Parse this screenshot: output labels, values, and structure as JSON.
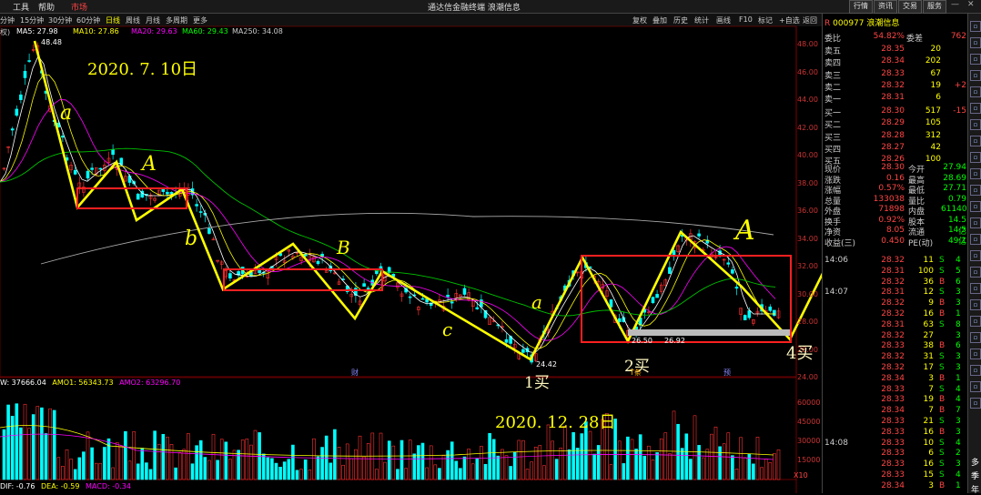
{
  "topbar": {
    "menus": [
      "工具",
      "帮助",
      "市场"
    ],
    "title": "通达信金融终端 浪潮信息",
    "right_buttons": [
      "行情",
      "资讯",
      "交易",
      "服务"
    ]
  },
  "toolbar": {
    "periods": [
      "分钟",
      "15分钟",
      "30分钟",
      "60分钟",
      "日线",
      "周线",
      "月线",
      "多周期",
      "更多"
    ],
    "active": "日线",
    "right": [
      "复权",
      "叠加",
      "历史",
      "统计",
      "画线",
      "F10",
      "标记",
      "+自选",
      "返回"
    ]
  },
  "ma_info": {
    "prefix": "权)",
    "ma5": "MA5: 27.98",
    "ma10": "MA10: 27.86",
    "ma20": "MA20: 29.63",
    "ma60": "MA60: 29.43",
    "ma250": "MA250: 34.08"
  },
  "price_labels": {
    "high": "48.48",
    "low1": "24.42",
    "low2": "26.50",
    "low3": "26.92"
  },
  "price_axis": [
    "48.00",
    "46.00",
    "44.00",
    "42.00",
    "40.00",
    "38.00",
    "36.00",
    "34.00",
    "32.00",
    "30.00",
    "28.00",
    "26.00",
    "24.00"
  ],
  "volume_info": {
    "vol": "W: 37666.04",
    "amo1": "AMO1: 56343.73",
    "amo2": "AMO2: 63296.70"
  },
  "volume_axis": [
    "60000",
    "45000",
    "30000",
    "15000"
  ],
  "volume_unit": "X10",
  "macd_info": {
    "dif": "DIF: -0.76",
    "dea": "DEA: -0.59",
    "macd": "MACD: -0.34"
  },
  "annotations": {
    "date1": "2020. 7. 10日",
    "date2": "2020. 12. 28日",
    "buy1": "1买",
    "buy2": "2买",
    "buy4": "4买",
    "a1": "a",
    "A1": "A",
    "b": "b",
    "B": "B",
    "c": "c",
    "a2": "a",
    "A2": "A",
    "mark1": "财",
    "mark2": "T条",
    "mark3": "预"
  },
  "stock": {
    "code": "000977",
    "name": "浪潮信息",
    "wb_label": "委比",
    "wb_value": "54.82%",
    "wc_label": "委差",
    "wc_value": "762"
  },
  "asks": [
    {
      "label": "卖五",
      "price": "28.35",
      "vol": "20",
      "chg": ""
    },
    {
      "label": "卖四",
      "price": "28.34",
      "vol": "202",
      "chg": ""
    },
    {
      "label": "卖三",
      "price": "28.33",
      "vol": "67",
      "chg": ""
    },
    {
      "label": "卖二",
      "price": "28.32",
      "vol": "19",
      "chg": "+2"
    },
    {
      "label": "卖一",
      "price": "28.31",
      "vol": "6",
      "chg": ""
    }
  ],
  "bids": [
    {
      "label": "买一",
      "price": "28.30",
      "vol": "517",
      "chg": "-15"
    },
    {
      "label": "买二",
      "price": "28.29",
      "vol": "105",
      "chg": ""
    },
    {
      "label": "买三",
      "price": "28.28",
      "vol": "312",
      "chg": ""
    },
    {
      "label": "买四",
      "price": "28.27",
      "vol": "42",
      "chg": ""
    },
    {
      "label": "买五",
      "price": "28.26",
      "vol": "100",
      "chg": ""
    }
  ],
  "stats": [
    {
      "l1": "现价",
      "v1": "28.30",
      "l2": "今开",
      "v2": "27.94"
    },
    {
      "l1": "涨跌",
      "v1": "0.16",
      "l2": "最高",
      "v2": "28.69"
    },
    {
      "l1": "涨幅",
      "v1": "0.57%",
      "l2": "最低",
      "v2": "27.71"
    },
    {
      "l1": "总量",
      "v1": "133038",
      "l2": "量比",
      "v2": "0.79"
    },
    {
      "l1": "外盘",
      "v1": "71898",
      "l2": "内盘",
      "v2": "61140"
    },
    {
      "l1": "换手",
      "v1": "0.92%",
      "l2": "股本",
      "v2": "14.5亿"
    },
    {
      "l1": "净资",
      "v1": "8.05",
      "l2": "流通",
      "v2": "14.5亿"
    },
    {
      "l1": "收益(三)",
      "v1": "0.450",
      "l2": "PE(动)",
      "v2": "49.1"
    }
  ],
  "ticks": [
    {
      "time": "14:06",
      "price": "28.32",
      "vol": "11",
      "side": "S",
      "n": "4"
    },
    {
      "time": "",
      "price": "28.31",
      "vol": "100",
      "side": "S",
      "n": "5"
    },
    {
      "time": "",
      "price": "28.32",
      "vol": "36",
      "side": "B",
      "n": "6"
    },
    {
      "time": "14:07",
      "price": "28.31",
      "vol": "12",
      "side": "S",
      "n": "3"
    },
    {
      "time": "",
      "price": "28.32",
      "vol": "9",
      "side": "B",
      "n": "3"
    },
    {
      "time": "",
      "price": "28.32",
      "vol": "16",
      "side": "B",
      "n": "1"
    },
    {
      "time": "",
      "price": "28.31",
      "vol": "63",
      "side": "S",
      "n": "8"
    },
    {
      "time": "",
      "price": "28.32",
      "vol": "27",
      "side": "",
      "n": "3"
    },
    {
      "time": "",
      "price": "28.33",
      "vol": "38",
      "side": "B",
      "n": "6"
    },
    {
      "time": "",
      "price": "28.32",
      "vol": "31",
      "side": "S",
      "n": "3"
    },
    {
      "time": "",
      "price": "28.32",
      "vol": "17",
      "side": "S",
      "n": "3"
    },
    {
      "time": "",
      "price": "28.34",
      "vol": "3",
      "side": "B",
      "n": "1"
    },
    {
      "time": "",
      "price": "28.33",
      "vol": "7",
      "side": "S",
      "n": "4"
    },
    {
      "time": "",
      "price": "28.33",
      "vol": "19",
      "side": "B",
      "n": "4"
    },
    {
      "time": "",
      "price": "28.34",
      "vol": "7",
      "side": "B",
      "n": "7"
    },
    {
      "time": "",
      "price": "28.33",
      "vol": "21",
      "side": "S",
      "n": "3"
    },
    {
      "time": "",
      "price": "28.33",
      "vol": "16",
      "side": "B",
      "n": "3"
    },
    {
      "time": "14:08",
      "price": "28.33",
      "vol": "10",
      "side": "S",
      "n": "4"
    },
    {
      "time": "",
      "price": "28.33",
      "vol": "6",
      "side": "S",
      "n": "2"
    },
    {
      "time": "",
      "price": "28.33",
      "vol": "16",
      "side": "S",
      "n": "3"
    },
    {
      "time": "",
      "price": "28.33",
      "vol": "15",
      "side": "S",
      "n": "4"
    },
    {
      "time": "",
      "price": "28.34",
      "vol": "3",
      "side": "B",
      "n": "1"
    }
  ],
  "sidebar_labels": [
    "多",
    "季",
    "年"
  ]
}
